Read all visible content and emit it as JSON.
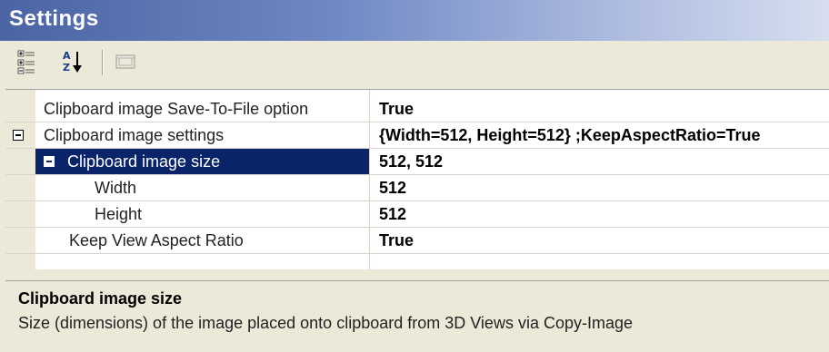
{
  "window": {
    "title": "Settings"
  },
  "toolbar": {
    "buttons": [
      {
        "name": "categorized-view",
        "icon": "categorized-icon"
      },
      {
        "name": "alphabetical-view",
        "icon": "sort-az-icon"
      },
      {
        "name": "property-pages",
        "icon": "property-pages-icon"
      }
    ]
  },
  "grid": {
    "rows": [
      {
        "name": "Clipboard image Save-To-File option",
        "value": "True"
      },
      {
        "name": "Clipboard image settings",
        "value": "{Width=512, Height=512} ;KeepAspectRatio=True"
      },
      {
        "name": "Clipboard image size",
        "value": "512, 512"
      },
      {
        "name": "Width",
        "value": "512"
      },
      {
        "name": "Height",
        "value": "512"
      },
      {
        "name": "Keep View Aspect Ratio",
        "value": "True"
      }
    ]
  },
  "description": {
    "title": "Clipboard image size",
    "text": "Size (dimensions) of the image placed onto clipboard from 3D Views via Copy-Image"
  },
  "colors": {
    "selection": "#0a246a",
    "background": "#ece9d8"
  }
}
